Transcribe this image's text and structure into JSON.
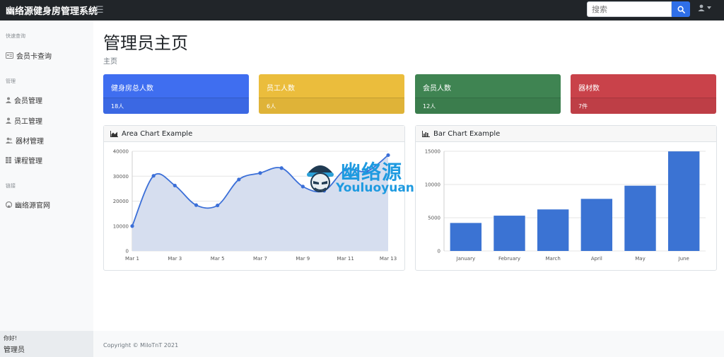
{
  "topbar": {
    "brand": "幽络源健身房管理系统",
    "search_placeholder": "搜索"
  },
  "sidebar": {
    "sections": [
      {
        "heading": "快速查询",
        "items": [
          {
            "label": "会员卡查询",
            "icon": "id-card-icon"
          }
        ]
      },
      {
        "heading": "管理",
        "items": [
          {
            "label": "会员管理",
            "icon": "user-icon"
          },
          {
            "label": "员工管理",
            "icon": "user-icon"
          },
          {
            "label": "器材管理",
            "icon": "users-icon"
          },
          {
            "label": "课程管理",
            "icon": "table-icon"
          }
        ]
      },
      {
        "heading": "链接",
        "items": [
          {
            "label": "幽络源官网",
            "icon": "github-icon"
          }
        ]
      }
    ],
    "footer": {
      "greeting": "你好!",
      "role": "管理员"
    }
  },
  "main": {
    "title": "管理员主页",
    "breadcrumb": "主页"
  },
  "stats": [
    {
      "label": "健身房总人数",
      "value": "18人",
      "color": "#3f6ef0"
    },
    {
      "label": "员工人数",
      "value": "6人",
      "color": "#ebbd3c"
    },
    {
      "label": "会员人数",
      "value": "12人",
      "color": "#3f8452"
    },
    {
      "label": "器材数",
      "value": "7件",
      "color": "#c9424a"
    }
  ],
  "area_card": {
    "title": "Area Chart Example"
  },
  "bar_card": {
    "title": "Bar Chart Example"
  },
  "chart_data": [
    {
      "type": "area",
      "title": "Area Chart Example",
      "x": [
        "Mar 1",
        "Mar 2",
        "Mar 3",
        "Mar 4",
        "Mar 5",
        "Mar 6",
        "Mar 7",
        "Mar 8",
        "Mar 9",
        "Mar 10",
        "Mar 11",
        "Mar 12",
        "Mar 13"
      ],
      "x_tick_labels": [
        "Mar 1",
        "Mar 3",
        "Mar 5",
        "Mar 7",
        "Mar 9",
        "Mar 11",
        "Mar 13"
      ],
      "values": [
        10000,
        30162,
        26263,
        18394,
        18287,
        28682,
        31274,
        33259,
        25849,
        24159,
        32651,
        31984,
        38451
      ],
      "ylim": [
        0,
        40000
      ],
      "y_ticks": [
        0,
        10000,
        20000,
        30000,
        40000
      ],
      "color": "#3b6fd8",
      "fill": "#d6deef",
      "grid": true
    },
    {
      "type": "bar",
      "title": "Bar Chart Example",
      "categories": [
        "January",
        "February",
        "March",
        "April",
        "May",
        "June"
      ],
      "values": [
        4215,
        5312,
        6251,
        7841,
        9821,
        14984
      ],
      "ylim": [
        0,
        15000
      ],
      "y_ticks": [
        0,
        5000,
        10000,
        15000
      ],
      "color": "#3b73d3",
      "grid": true
    }
  ],
  "watermark": {
    "cn": "幽络源",
    "en": "Youluoyuan"
  },
  "footer": {
    "copyright": "Copyright © MiloTnT 2021"
  }
}
